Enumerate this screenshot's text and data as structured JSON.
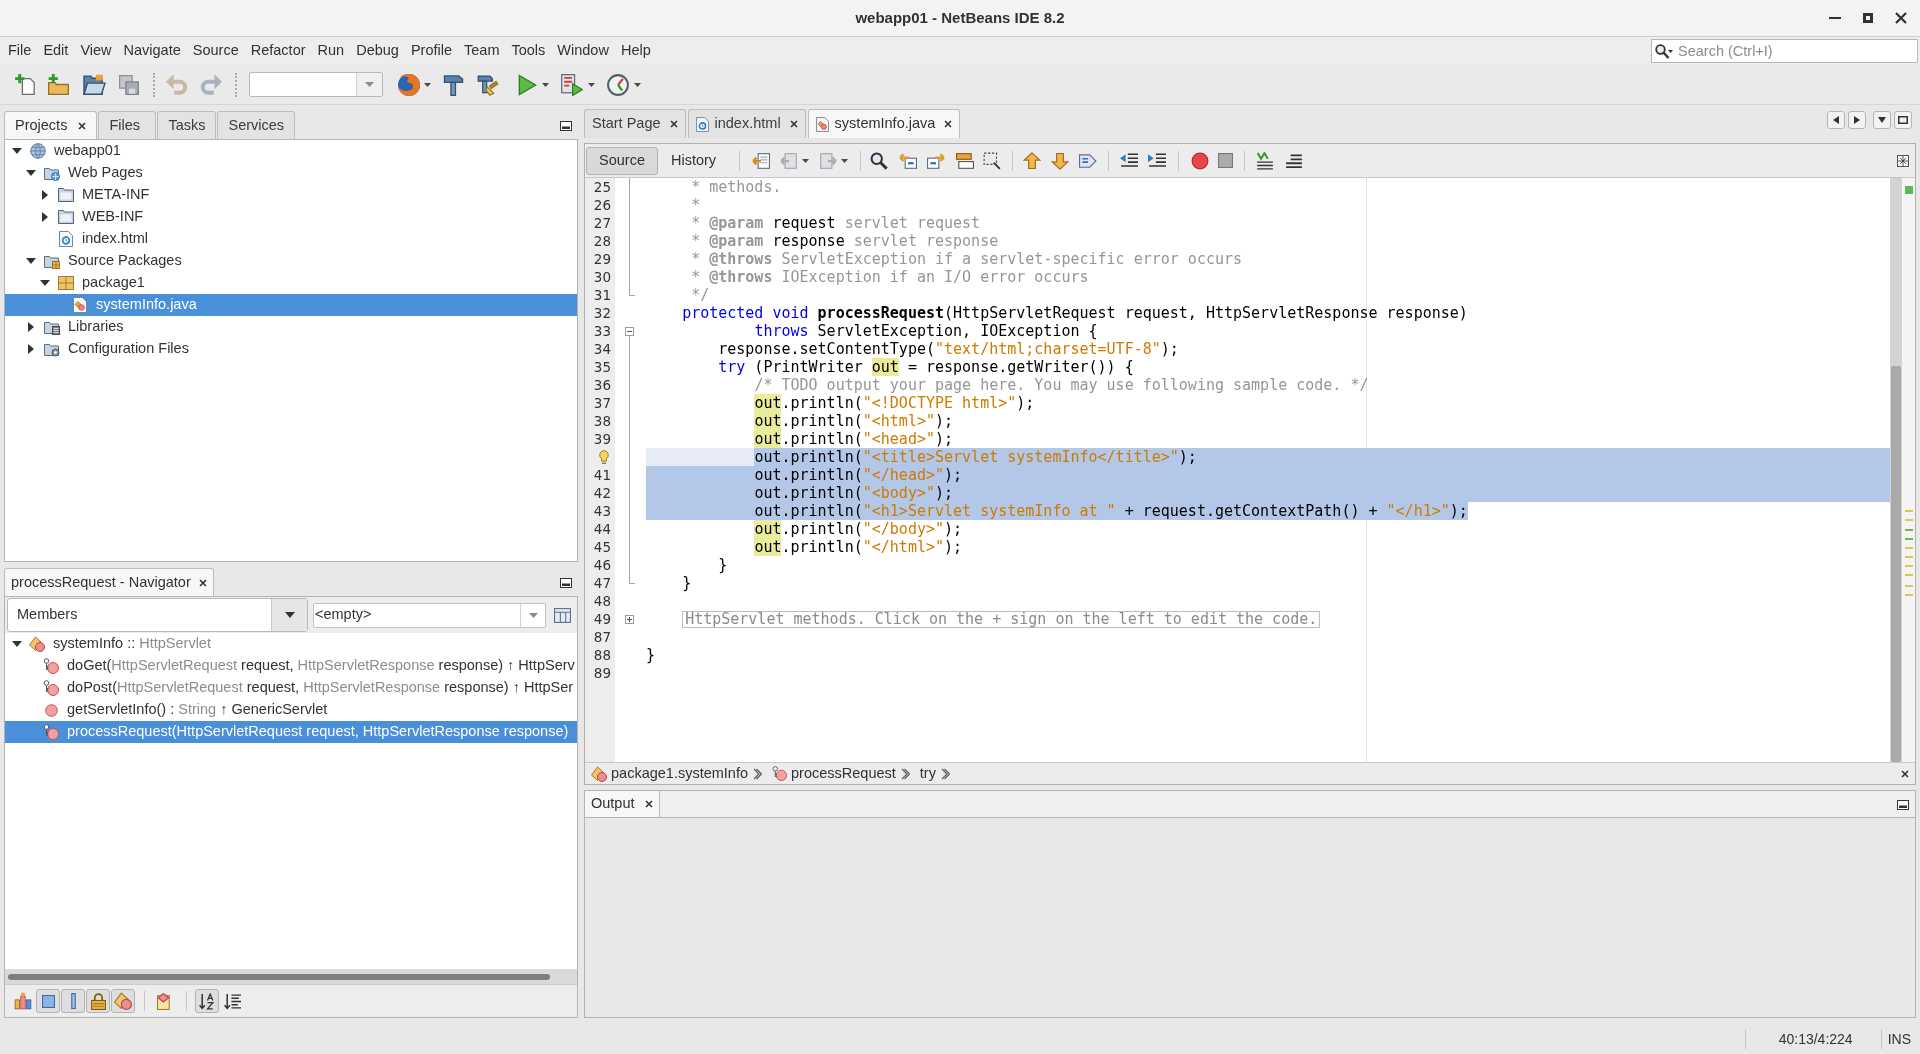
{
  "window": {
    "title": "webapp01 - NetBeans IDE 8.2"
  },
  "menu": [
    "File",
    "Edit",
    "View",
    "Navigate",
    "Source",
    "Refactor",
    "Run",
    "Debug",
    "Profile",
    "Team",
    "Tools",
    "Window",
    "Help"
  ],
  "search": {
    "placeholder": "Search (Ctrl+I)"
  },
  "projects_panel": {
    "tabs": [
      {
        "label": "Projects",
        "selected": true
      },
      {
        "label": "Files",
        "selected": false
      },
      {
        "label": "Tasks",
        "selected": false
      },
      {
        "label": "Services",
        "selected": false
      }
    ],
    "tree": [
      {
        "label": "webapp01",
        "kind": "project",
        "expanded": true,
        "selected": false,
        "children": [
          {
            "label": "Web Pages",
            "kind": "web-pages",
            "expanded": true,
            "selected": false,
            "children": [
              {
                "label": "META-INF",
                "kind": "folder",
                "expanded": false,
                "selected": false
              },
              {
                "label": "WEB-INF",
                "kind": "folder",
                "expanded": false,
                "selected": false
              },
              {
                "label": "index.html",
                "kind": "html",
                "selected": false
              }
            ]
          },
          {
            "label": "Source Packages",
            "kind": "sources",
            "expanded": true,
            "selected": false,
            "children": [
              {
                "label": "package1",
                "kind": "package",
                "expanded": true,
                "selected": false,
                "children": [
                  {
                    "label": "systemInfo.java",
                    "kind": "java",
                    "selected": true
                  }
                ]
              }
            ]
          },
          {
            "label": "Libraries",
            "kind": "libraries",
            "expanded": false,
            "selected": false
          },
          {
            "label": "Configuration Files",
            "kind": "config",
            "expanded": false,
            "selected": false
          }
        ]
      }
    ]
  },
  "navigator": {
    "title": "processRequest - Navigator",
    "view": "Members",
    "scope": "<empty>",
    "tree": [
      {
        "segments": [
          {
            "text": "systemInfo",
            "muted": false
          },
          {
            "text": " :: ",
            "muted": false
          },
          {
            "text": "HttpServlet",
            "muted": true
          }
        ],
        "kind": "class",
        "expanded": true,
        "selected": false,
        "children": [
          {
            "segments": [
              {
                "text": "doGet(",
                "muted": false
              },
              {
                "text": "HttpServletRequest",
                "muted": true
              },
              {
                "text": " request, ",
                "muted": false
              },
              {
                "text": "HttpServletResponse",
                "muted": true
              },
              {
                "text": " response) ↑ HttpServ",
                "muted": false
              }
            ],
            "kind": "protected",
            "selected": false
          },
          {
            "segments": [
              {
                "text": "doPost(",
                "muted": false
              },
              {
                "text": "HttpServletRequest",
                "muted": true
              },
              {
                "text": " request, ",
                "muted": false
              },
              {
                "text": "HttpServletResponse",
                "muted": true
              },
              {
                "text": " response) ↑ HttpSer",
                "muted": false
              }
            ],
            "kind": "protected",
            "selected": false
          },
          {
            "segments": [
              {
                "text": "getServletInfo() : ",
                "muted": false
              },
              {
                "text": "String",
                "muted": true
              },
              {
                "text": " ↑ GenericServlet",
                "muted": false
              }
            ],
            "kind": "public",
            "selected": false
          },
          {
            "segments": [
              {
                "text": "processRequest(HttpServletRequest request, HttpServletResponse response)"
              }
            ],
            "kind": "protected",
            "selected": true
          }
        ]
      }
    ],
    "filters": [
      {
        "kind": "inherited",
        "on": false
      },
      {
        "kind": "fields",
        "on": true
      },
      {
        "kind": "static",
        "on": true
      },
      {
        "kind": "non-public",
        "on": true
      },
      {
        "kind": "inner-classes",
        "on": true
      },
      {
        "kind": "javadoc",
        "on": false
      },
      {
        "kind": "sort-by-name",
        "on": true
      },
      {
        "kind": "sort-by-source",
        "on": false
      }
    ]
  },
  "editor": {
    "tabs": [
      {
        "label": "Start Page",
        "kind": "page",
        "selected": false
      },
      {
        "label": "index.html",
        "kind": "html",
        "selected": false
      },
      {
        "label": "systemInfo.java",
        "kind": "java",
        "selected": true
      }
    ],
    "views": [
      {
        "label": "Source",
        "selected": true
      },
      {
        "label": "History",
        "selected": false
      }
    ],
    "lines": [
      {
        "number": "25",
        "fold": {
          "kind": "line"
        },
        "selected": false,
        "indent_selected": false,
        "selected_past_end": false,
        "current": false,
        "hint": false,
        "tokens": [
          {
            "text": "     * methods.",
            "kind": "comment"
          }
        ]
      },
      {
        "number": "26",
        "fold": {
          "kind": "line"
        },
        "selected": false,
        "indent_selected": false,
        "selected_past_end": false,
        "current": false,
        "hint": false,
        "tokens": [
          {
            "text": "     *",
            "kind": "comment"
          }
        ]
      },
      {
        "number": "27",
        "fold": {
          "kind": "line"
        },
        "selected": false,
        "indent_selected": false,
        "selected_past_end": false,
        "current": false,
        "hint": false,
        "tokens": [
          {
            "text": "     * ",
            "kind": "comment"
          },
          {
            "text": "@param",
            "kind": "doc-tag"
          },
          {
            "text": " request",
            "kind": "plain"
          },
          {
            "text": " servlet request",
            "kind": "comment"
          }
        ]
      },
      {
        "number": "28",
        "fold": {
          "kind": "line"
        },
        "selected": false,
        "indent_selected": false,
        "selected_past_end": false,
        "current": false,
        "hint": false,
        "tokens": [
          {
            "text": "     * ",
            "kind": "comment"
          },
          {
            "text": "@param",
            "kind": "doc-tag"
          },
          {
            "text": " response",
            "kind": "plain"
          },
          {
            "text": " servlet response",
            "kind": "comment"
          }
        ]
      },
      {
        "number": "29",
        "fold": {
          "kind": "line"
        },
        "selected": false,
        "indent_selected": false,
        "selected_past_end": false,
        "current": false,
        "hint": false,
        "tokens": [
          {
            "text": "     * ",
            "kind": "comment"
          },
          {
            "text": "@throws",
            "kind": "doc-tag"
          },
          {
            "text": " ServletException if a servlet-specific error occurs",
            "kind": "comment"
          }
        ]
      },
      {
        "number": "30",
        "fold": {
          "kind": "line"
        },
        "selected": false,
        "indent_selected": false,
        "selected_past_end": false,
        "current": false,
        "hint": false,
        "tokens": [
          {
            "text": "     * ",
            "kind": "comment"
          },
          {
            "text": "@throws",
            "kind": "doc-tag"
          },
          {
            "text": " IOException if an I/O error occurs",
            "kind": "comment"
          }
        ]
      },
      {
        "number": "31",
        "fold": {
          "kind": "end"
        },
        "selected": false,
        "indent_selected": false,
        "selected_past_end": false,
        "current": false,
        "hint": false,
        "tokens": [
          {
            "text": "     */",
            "kind": "comment"
          }
        ]
      },
      {
        "number": "32",
        "selected": false,
        "indent_selected": false,
        "selected_past_end": false,
        "current": false,
        "hint": false,
        "tokens": [
          {
            "text": "    protected",
            "kind": "keyword"
          },
          {
            "text": " void",
            "kind": "keyword"
          },
          {
            "text": " processRequest",
            "kind": "method-decl"
          },
          {
            "text": "(HttpServletRequest request, HttpServletResponse response)",
            "kind": "plain"
          }
        ]
      },
      {
        "number": "33",
        "fold": {
          "kind": "collapse"
        },
        "selected": false,
        "indent_selected": false,
        "selected_past_end": false,
        "current": false,
        "hint": false,
        "tokens": [
          {
            "text": "            throws",
            "kind": "keyword"
          },
          {
            "text": " ServletException, IOException {",
            "kind": "plain"
          }
        ]
      },
      {
        "number": "34",
        "fold": {
          "kind": "line"
        },
        "selected": false,
        "indent_selected": false,
        "selected_past_end": false,
        "current": false,
        "hint": false,
        "tokens": [
          {
            "text": "        response.setContentType(",
            "kind": "plain"
          },
          {
            "text": "\"text/html;charset=UTF-8\"",
            "kind": "string"
          },
          {
            "text": ");",
            "kind": "plain"
          }
        ]
      },
      {
        "number": "35",
        "fold": {
          "kind": "line"
        },
        "selected": false,
        "indent_selected": false,
        "selected_past_end": false,
        "current": false,
        "hint": false,
        "tokens": [
          {
            "text": "        try",
            "kind": "keyword"
          },
          {
            "text": " (PrintWriter ",
            "kind": "plain"
          },
          {
            "text": "out",
            "kind": "occurrence"
          },
          {
            "text": " = response.getWriter()) {",
            "kind": "plain"
          }
        ]
      },
      {
        "number": "36",
        "fold": {
          "kind": "line"
        },
        "selected": false,
        "indent_selected": false,
        "selected_past_end": false,
        "current": false,
        "hint": false,
        "tokens": [
          {
            "text": "            /* TODO output your page here. You may use following sample code. */",
            "kind": "comment"
          }
        ]
      },
      {
        "number": "37",
        "fold": {
          "kind": "line"
        },
        "selected": false,
        "indent_selected": false,
        "selected_past_end": false,
        "current": false,
        "hint": false,
        "tokens": [
          {
            "text": "            out",
            "kind": "occurrence"
          },
          {
            "text": ".println(",
            "kind": "plain"
          },
          {
            "text": "\"<!DOCTYPE html>\"",
            "kind": "string"
          },
          {
            "text": ");",
            "kind": "plain"
          }
        ]
      },
      {
        "number": "38",
        "fold": {
          "kind": "line"
        },
        "selected": false,
        "indent_selected": false,
        "selected_past_end": false,
        "current": false,
        "hint": false,
        "tokens": [
          {
            "text": "            out",
            "kind": "occurrence"
          },
          {
            "text": ".println(",
            "kind": "plain"
          },
          {
            "text": "\"<html>\"",
            "kind": "string"
          },
          {
            "text": ");",
            "kind": "plain"
          }
        ]
      },
      {
        "number": "39",
        "fold": {
          "kind": "line"
        },
        "selected": false,
        "indent_selected": false,
        "selected_past_end": false,
        "current": false,
        "hint": false,
        "tokens": [
          {
            "text": "            out",
            "kind": "occurrence"
          },
          {
            "text": ".println(",
            "kind": "plain"
          },
          {
            "text": "\"<head>\"",
            "kind": "string"
          },
          {
            "text": ");",
            "kind": "plain"
          }
        ]
      },
      {
        "fold": {
          "kind": "line"
        },
        "selected": true,
        "indent_selected": false,
        "selected_past_end": true,
        "current": true,
        "hint": true,
        "tokens": [
          {
            "text": "            out.println(",
            "kind": "plain"
          },
          {
            "text": "\"<title>Servlet systemInfo</title>\"",
            "kind": "string"
          },
          {
            "text": ");",
            "kind": "plain"
          }
        ]
      },
      {
        "number": "41",
        "fold": {
          "kind": "line"
        },
        "selected": true,
        "indent_selected": true,
        "selected_past_end": true,
        "current": false,
        "hint": false,
        "tokens": [
          {
            "text": "            out.println(",
            "kind": "plain"
          },
          {
            "text": "\"</head>\"",
            "kind": "string"
          },
          {
            "text": ");",
            "kind": "plain"
          }
        ]
      },
      {
        "number": "42",
        "fold": {
          "kind": "line"
        },
        "selected": true,
        "indent_selected": true,
        "selected_past_end": true,
        "current": false,
        "hint": false,
        "tokens": [
          {
            "text": "            out.println(",
            "kind": "plain"
          },
          {
            "text": "\"<body>\"",
            "kind": "string"
          },
          {
            "text": ");",
            "kind": "plain"
          }
        ]
      },
      {
        "number": "43",
        "fold": {
          "kind": "line"
        },
        "selected": true,
        "indent_selected": true,
        "selected_past_end": false,
        "current": false,
        "hint": false,
        "tokens": [
          {
            "text": "            out.println(",
            "kind": "plain"
          },
          {
            "text": "\"<h1>Servlet systemInfo at \"",
            "kind": "string"
          },
          {
            "text": " + request.getContextPath() + ",
            "kind": "plain"
          },
          {
            "text": "\"</h1>\"",
            "kind": "string"
          },
          {
            "text": ");",
            "kind": "plain"
          }
        ]
      },
      {
        "number": "44",
        "fold": {
          "kind": "line"
        },
        "selected": false,
        "indent_selected": false,
        "selected_past_end": false,
        "current": false,
        "hint": false,
        "tokens": [
          {
            "text": "            out",
            "kind": "occurrence"
          },
          {
            "text": ".println(",
            "kind": "plain"
          },
          {
            "text": "\"</body>\"",
            "kind": "string"
          },
          {
            "text": ");",
            "kind": "plain"
          }
        ]
      },
      {
        "number": "45",
        "fold": {
          "kind": "line"
        },
        "selected": false,
        "indent_selected": false,
        "selected_past_end": false,
        "current": false,
        "hint": false,
        "tokens": [
          {
            "text": "            out",
            "kind": "occurrence"
          },
          {
            "text": ".println(",
            "kind": "plain"
          },
          {
            "text": "\"</html>\"",
            "kind": "string"
          },
          {
            "text": ");",
            "kind": "plain"
          }
        ]
      },
      {
        "number": "46",
        "fold": {
          "kind": "line"
        },
        "selected": false,
        "indent_selected": false,
        "selected_past_end": false,
        "current": false,
        "hint": false,
        "tokens": [
          {
            "text": "        }",
            "kind": "plain"
          }
        ]
      },
      {
        "number": "47",
        "fold": {
          "kind": "end"
        },
        "selected": false,
        "indent_selected": false,
        "selected_past_end": false,
        "current": false,
        "hint": false,
        "tokens": [
          {
            "text": "    }",
            "kind": "plain"
          }
        ]
      },
      {
        "number": "48",
        "selected": false,
        "indent_selected": false,
        "selected_past_end": false,
        "current": false,
        "hint": false
      },
      {
        "number": "49",
        "fold": {
          "kind": "expand"
        },
        "selected": false,
        "indent_selected": false,
        "selected_past_end": false,
        "current": false,
        "hint": false,
        "tokens": [
          {
            "text": "    HttpServlet methods. Click on the + sign on the left to edit the code.",
            "kind": "folded"
          }
        ]
      },
      {
        "number": "87",
        "selected": false,
        "indent_selected": false,
        "selected_past_end": false,
        "current": false,
        "hint": false
      },
      {
        "number": "88",
        "selected": false,
        "indent_selected": false,
        "selected_past_end": false,
        "current": false,
        "hint": false,
        "tokens": [
          {
            "text": "}",
            "kind": "plain"
          }
        ]
      },
      {
        "number": "89",
        "selected": false,
        "indent_selected": false,
        "selected_past_end": false,
        "current": false,
        "hint": false
      }
    ],
    "breadcrumb": [
      {
        "label": "package1.systemInfo",
        "kind": "class"
      },
      {
        "label": "processRequest",
        "kind": "method"
      },
      {
        "label": "try",
        "kind": "block"
      }
    ]
  },
  "output": {
    "tabs": [
      {
        "label": "Output",
        "selected": true
      }
    ]
  },
  "status_bar": {
    "position": "40:13/4:224",
    "mode": "INS"
  }
}
